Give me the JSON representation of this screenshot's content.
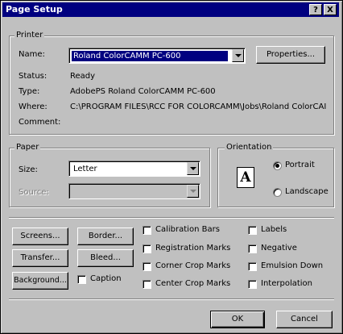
{
  "title": "Page Setup",
  "title_buttons": {
    "help": "?",
    "close": "X"
  },
  "printer": {
    "legend": "Printer",
    "name_label": "Name:",
    "name_value": "Roland ColorCAMM PC-600",
    "properties_button": "Properties...",
    "status_label": "Status:",
    "status_value": "Ready",
    "type_label": "Type:",
    "type_value": "AdobePS Roland ColorCAMM PC-600",
    "where_label": "Where:",
    "where_value": "C:\\PROGRAM FILES\\RCC FOR COLORCAMM\\Jobs\\Roland ColorCAI",
    "comment_label": "Comment:"
  },
  "paper": {
    "legend": "Paper",
    "size_label": "Size:",
    "size_value": "Letter",
    "source_label": "Source:",
    "source_value": ""
  },
  "orientation": {
    "legend": "Orientation",
    "icon_glyph": "A",
    "portrait_label": "Portrait",
    "landscape_label": "Landscape",
    "selected": "Portrait"
  },
  "buttons": {
    "screens": "Screens...",
    "border": "Border...",
    "transfer": "Transfer...",
    "bleed": "Bleed...",
    "background": "Background...",
    "ok": "OK",
    "cancel": "Cancel"
  },
  "checkboxes": {
    "caption": "Caption",
    "calibration_bars": "Calibration Bars",
    "registration_marks": "Registration Marks",
    "corner_crop_marks": "Corner Crop Marks",
    "center_crop_marks": "Center Crop Marks",
    "labels": "Labels",
    "negative": "Negative",
    "emulsion_down": "Emulsion Down",
    "interpolation": "Interpolation"
  },
  "colors": {
    "title_bg": "#000080",
    "face": "#c0c0c0",
    "selection": "#000080"
  }
}
